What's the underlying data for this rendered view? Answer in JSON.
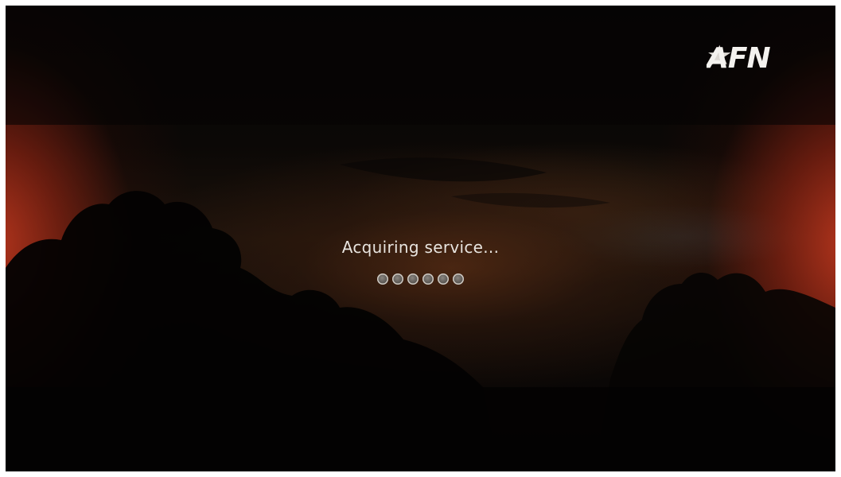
{
  "brand": {
    "logo_text": "AFN",
    "logo_icon": "star-icon"
  },
  "status": {
    "message": "Acquiring service..."
  },
  "loader": {
    "dot_count": 6,
    "dots": [
      "",
      "",
      "",
      "",
      "",
      ""
    ]
  },
  "colors": {
    "text": "#e8e4df",
    "edge_glow": "#be371e",
    "background": "#070605"
  }
}
